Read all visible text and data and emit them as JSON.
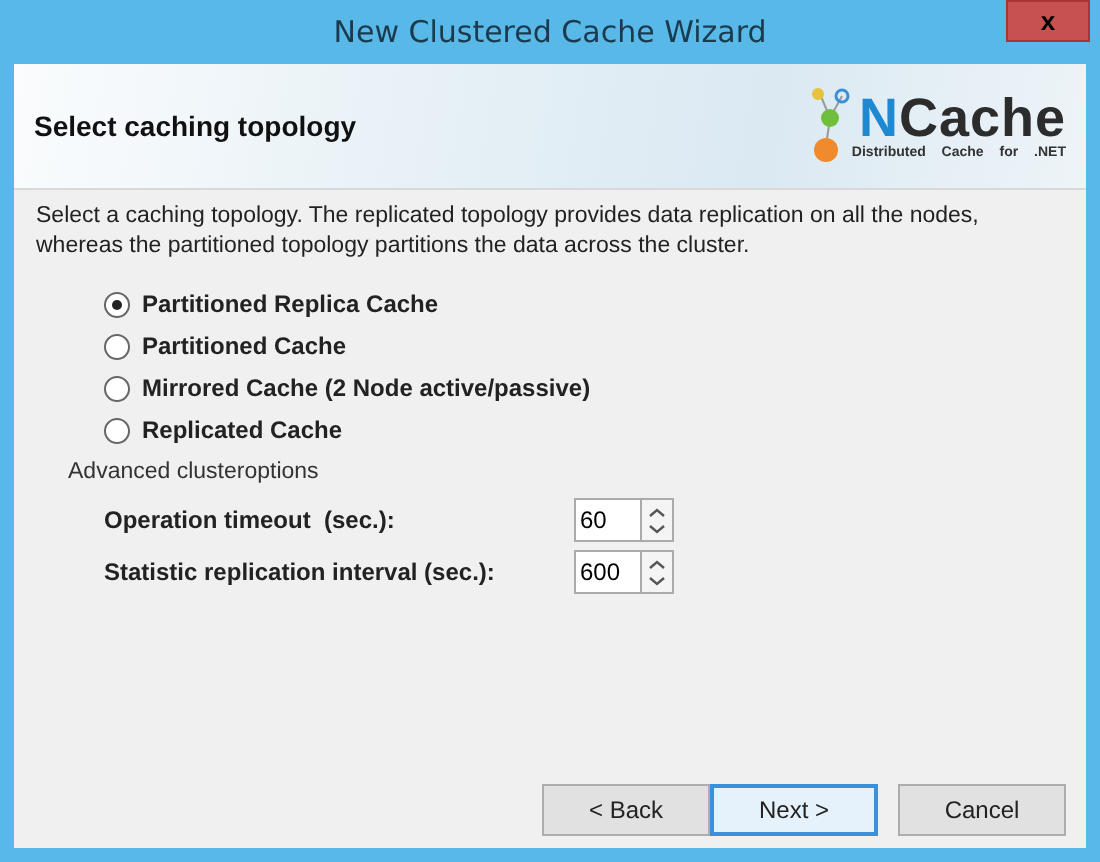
{
  "window": {
    "title": "New Clustered Cache Wizard",
    "close": "x"
  },
  "header": {
    "title": "Select caching topology",
    "logo": {
      "accent": "N",
      "text": "Cache",
      "tagline": "Distributed Cache for .NET"
    }
  },
  "description": "Select a caching topology. The replicated topology provides data replication on all the nodes, whereas the partitioned topology partitions the data across the cluster.",
  "topologies": [
    {
      "label": "Partitioned Replica Cache",
      "selected": true
    },
    {
      "label": "Partitioned Cache",
      "selected": false
    },
    {
      "label": "Mirrored Cache (2 Node active/passive)",
      "selected": false
    },
    {
      "label": "Replicated Cache",
      "selected": false
    }
  ],
  "advanced": {
    "title": "Advanced clusteroptions",
    "fields": [
      {
        "label": "Operation timeout  (sec.):",
        "value": "60"
      },
      {
        "label": "Statistic replication interval (sec.):",
        "value": "600"
      }
    ]
  },
  "buttons": [
    {
      "label": "< Back",
      "selected": false
    },
    {
      "label": "Next >",
      "selected": true
    },
    {
      "label": "Cancel",
      "selected": false
    }
  ]
}
